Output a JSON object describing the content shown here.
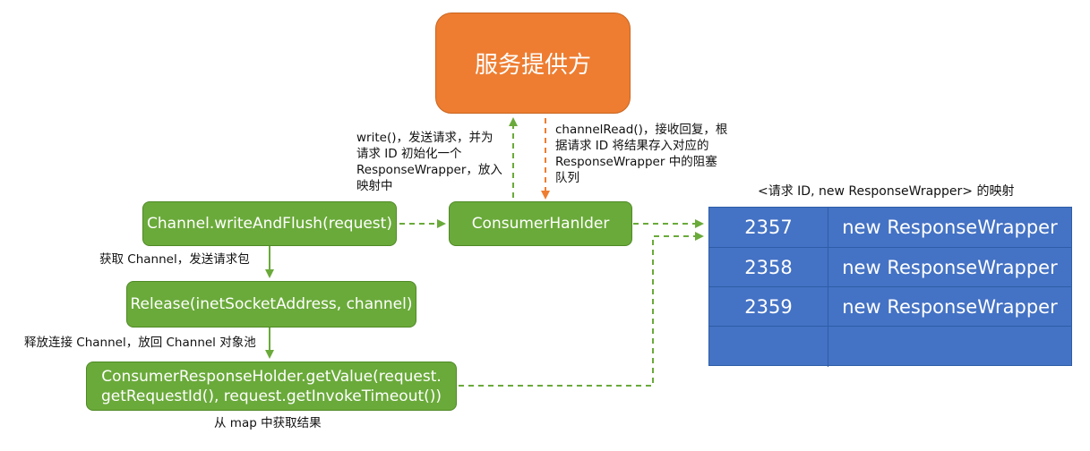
{
  "provider": {
    "label": "服务提供方"
  },
  "nodes": {
    "write_flush": "Channel.writeAndFlush(request)",
    "consumer_handler": "ConsumerHanlder",
    "release": "Release(inetSocketAddress, channel)",
    "get_value": "ConsumerResponseHolder.getValue(request.getRequestId(), request.getInvokeTimeout())"
  },
  "annotations": {
    "write_note": "write()，发送请求，并为\n请求 ID 初始化一个\nResponseWrapper，放入\n映射中",
    "read_note": "channelRead()，接收回复，根\n据请求 ID 将结果存入对应的\nResponseWrapper 中的阻塞\n队列",
    "get_channel": "获取 Channel，发送请求包",
    "release_note": "释放连接 Channel，放回 Channel 对象池",
    "map_note": "从 map 中获取结果"
  },
  "mapping": {
    "title": "<请求 ID, new ResponseWrapper> 的映射",
    "rows": [
      {
        "id": "2357",
        "value": "new ResponseWrapper"
      },
      {
        "id": "2358",
        "value": "new ResponseWrapper"
      },
      {
        "id": "2359",
        "value": "new ResponseWrapper"
      },
      {
        "id": "",
        "value": ""
      }
    ]
  },
  "colors": {
    "green": "#6aaa3a",
    "orange": "#ee7d31",
    "blue": "#4472c4"
  }
}
